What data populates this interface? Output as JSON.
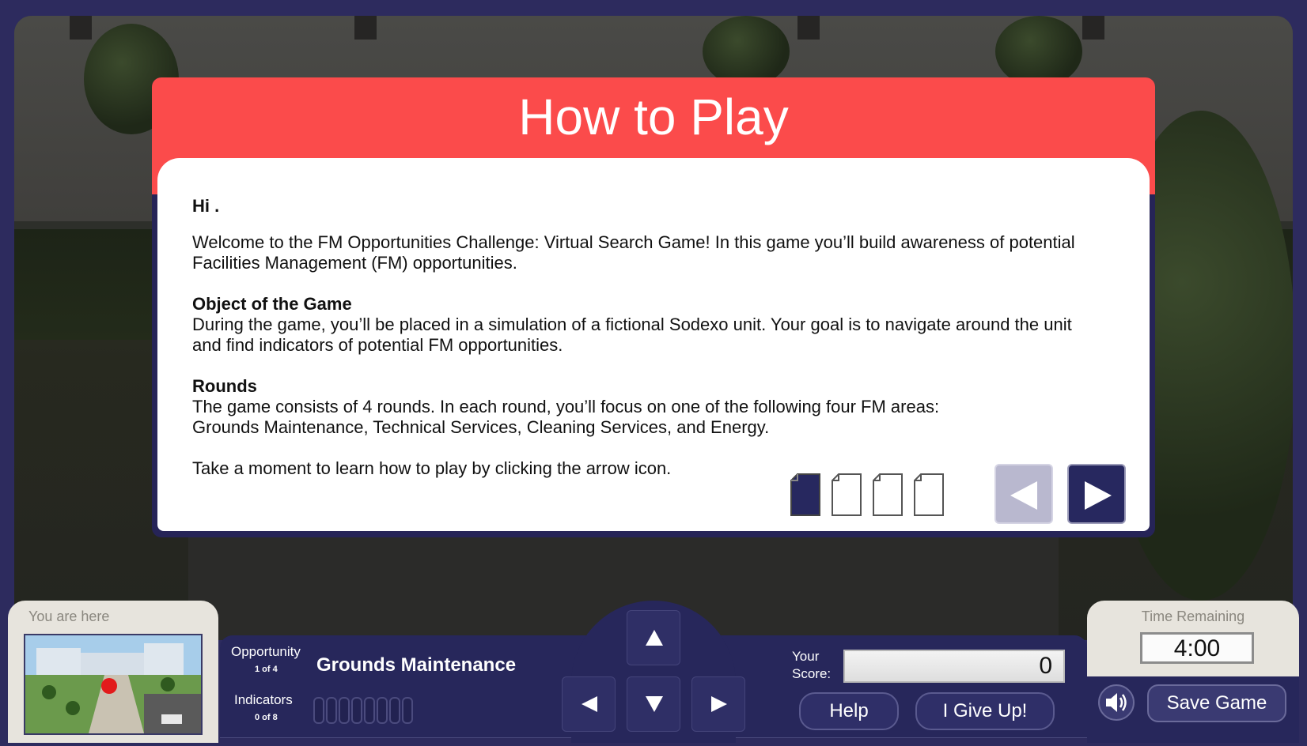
{
  "dialog": {
    "title": "How to Play",
    "greeting": "Hi .",
    "welcome": "Welcome to the FM Opportunities Challenge:  Virtual Search Game!  In this game you’ll build awareness of potential Facilities Management (FM) opportunities.",
    "object_heading": "Object of the Game",
    "object_text": "During the game, you’ll be placed in a simulation of a fictional Sodexo unit.  Your goal is to navigate around the unit and find indicators of potential FM opportunities.",
    "rounds_heading": "Rounds",
    "rounds_text": "The game consists of 4 rounds.  In each round, you’ll focus on one of the following four FM areas:",
    "rounds_areas": "Grounds Maintenance, Technical Services, Cleaning Services, and Energy.",
    "instruction": "Take a moment to learn how to play by clicking the arrow icon.",
    "pages_total": 4,
    "current_page": 1
  },
  "map": {
    "label": "You are here"
  },
  "hud": {
    "opportunity_label": "Opportunity",
    "opportunity_count": "1 of 4",
    "round_name": "Grounds Maintenance",
    "indicators_label": "Indicators",
    "indicators_count": "0 of 8",
    "indicator_slots": 8,
    "score_label": "Your Score:",
    "score_value": "0",
    "help_label": "Help",
    "give_up_label": "I Give Up!",
    "time_label": "Time Remaining",
    "time_value": "4:00",
    "save_label": "Save Game"
  },
  "colors": {
    "header_red": "#fb4b4b",
    "navy": "#27285f",
    "panel_beige": "#e7e4dd"
  },
  "icons": {
    "page": "page-icon",
    "prev": "arrow-left-icon",
    "next": "arrow-right-icon",
    "up": "arrow-up-icon",
    "down": "arrow-down-icon",
    "left": "arrow-left-icon",
    "right": "arrow-right-icon",
    "sound": "speaker-icon"
  }
}
